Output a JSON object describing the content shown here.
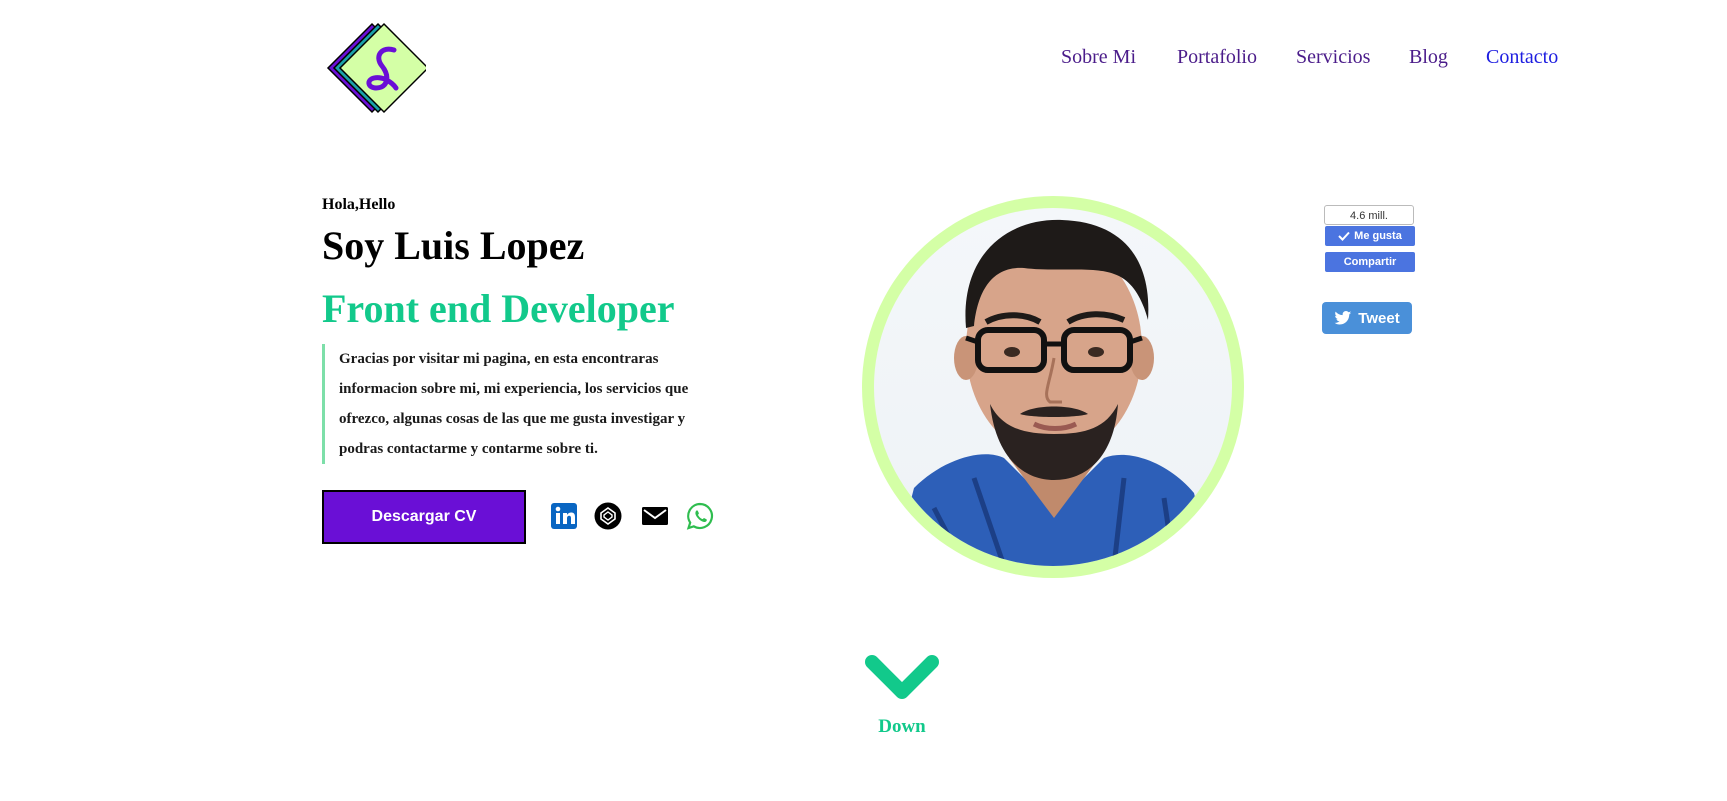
{
  "nav": {
    "items": [
      {
        "label": "Sobre Mi"
      },
      {
        "label": "Portafolio"
      },
      {
        "label": "Servicios"
      },
      {
        "label": "Blog"
      },
      {
        "label": "Contacto"
      }
    ]
  },
  "hero": {
    "greeting": "Hola,Hello",
    "name": "Soy Luis Lopez",
    "role": "Front end Developer",
    "intro": "Gracias por visitar mi pagina, en esta encontraras informacion sobre mi, mi experiencia, los servicios que ofrezco, algunas cosas de las que me gusta investigar y podras contactarme y contarme sobre ti.",
    "cv_button": "Descargar CV",
    "socials": [
      "linkedin-icon",
      "codepen-icon",
      "email-icon",
      "whatsapp-icon"
    ]
  },
  "widgets": {
    "fb_count": "4.6 mill.",
    "fb_like": "Me gusta",
    "fb_share": "Compartir",
    "tweet": "Tweet"
  },
  "scroll": {
    "label": "Down"
  },
  "colors": {
    "accent_green": "#12c98b",
    "button_purple": "#6a0fd6",
    "nav_purple": "#4b1c8a",
    "ring": "#d4ffa6"
  }
}
